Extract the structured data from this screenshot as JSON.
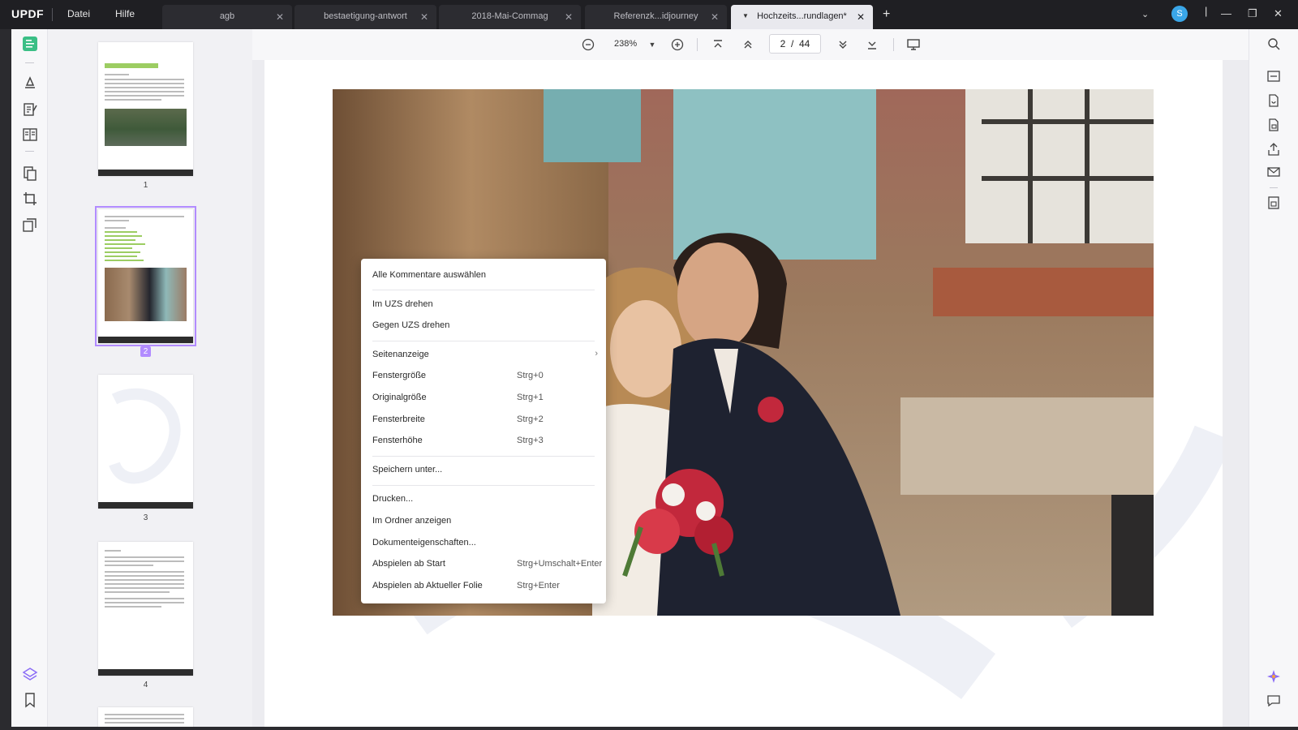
{
  "app": {
    "logo": "UPDF"
  },
  "menu": {
    "file": "Datei",
    "help": "Hilfe"
  },
  "tabs": [
    {
      "label": "agb"
    },
    {
      "label": "bestaetigung-antwort"
    },
    {
      "label": "2018-Mai-Commag"
    },
    {
      "label": "Referenzk...idjourney"
    },
    {
      "label": "Hochzeits...rundlagen*"
    }
  ],
  "user": {
    "initial": "S"
  },
  "toolbar": {
    "zoom": "238%",
    "current_page": "2",
    "total_pages": "44",
    "page_sep": "/"
  },
  "thumbnails": [
    {
      "num": "1"
    },
    {
      "num": "2"
    },
    {
      "num": "3"
    },
    {
      "num": "4"
    }
  ],
  "context_menu": {
    "select_all_comments": "Alle Kommentare auswählen",
    "rotate_cw": "Im UZS drehen",
    "rotate_ccw": "Gegen UZS drehen",
    "page_display": "Seitenanzeige",
    "fit_window": {
      "label": "Fenstergröße",
      "shortcut": "Strg+0"
    },
    "original_size": {
      "label": "Originalgröße",
      "shortcut": "Strg+1"
    },
    "fit_width": {
      "label": "Fensterbreite",
      "shortcut": "Strg+2"
    },
    "fit_height": {
      "label": "Fensterhöhe",
      "shortcut": "Strg+3"
    },
    "save_as": "Speichern unter...",
    "print": "Drucken...",
    "show_in_folder": "Im Ordner anzeigen",
    "doc_properties": "Dokumenteigenschaften...",
    "play_from_start": {
      "label": "Abspielen ab Start",
      "shortcut": "Strg+Umschalt+Enter"
    },
    "play_from_current": {
      "label": "Abspielen ab Aktueller Folie",
      "shortcut": "Strg+Enter"
    }
  },
  "colors": {
    "accent": "#b28cff",
    "titlebar": "#1f1f23",
    "thumb_green": "#9ccd62"
  }
}
